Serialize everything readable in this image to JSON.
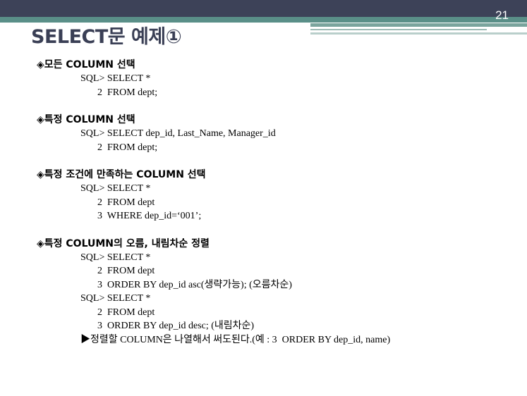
{
  "header": {
    "page_number": "21",
    "title": "SELECT문 예제①"
  },
  "sections": [
    {
      "heading": "◈모든 COLUMN 선택",
      "lines": [
        {
          "level": 1,
          "text": "SQL> SELECT *"
        },
        {
          "level": 2,
          "text": "2  FROM dept;"
        }
      ]
    },
    {
      "heading": "◈특정 COLUMN 선택",
      "lines": [
        {
          "level": 1,
          "text": "SQL> SELECT dep_id, Last_Name, Manager_id"
        },
        {
          "level": 2,
          "text": "2  FROM dept;"
        }
      ]
    },
    {
      "heading": "◈특정 조건에 만족하는 COLUMN 선택",
      "lines": [
        {
          "level": 1,
          "text": "SQL> SELECT *"
        },
        {
          "level": 2,
          "text": "2  FROM dept"
        },
        {
          "level": 2,
          "text": "3  WHERE dep_id=‘001’;"
        }
      ]
    },
    {
      "heading": "◈특정 COLUMN의 오름, 내림차순 정렬",
      "lines": [
        {
          "level": 1,
          "text": "SQL> SELECT *"
        },
        {
          "level": 2,
          "text": "2  FROM dept"
        },
        {
          "level": 2,
          "text": "3  ORDER BY dep_id asc(생략가능); (오름차순)"
        },
        {
          "level": 1,
          "text": "SQL> SELECT *"
        },
        {
          "level": 2,
          "text": "2  FROM dept"
        },
        {
          "level": 2,
          "text": "3  ORDER BY dep_id desc; (내림차순)"
        },
        {
          "level": 1,
          "text": "▶정렬할 COLUMN은 나열해서 써도된다.(예 : 3  ORDER BY dep_id, name)"
        }
      ]
    }
  ]
}
